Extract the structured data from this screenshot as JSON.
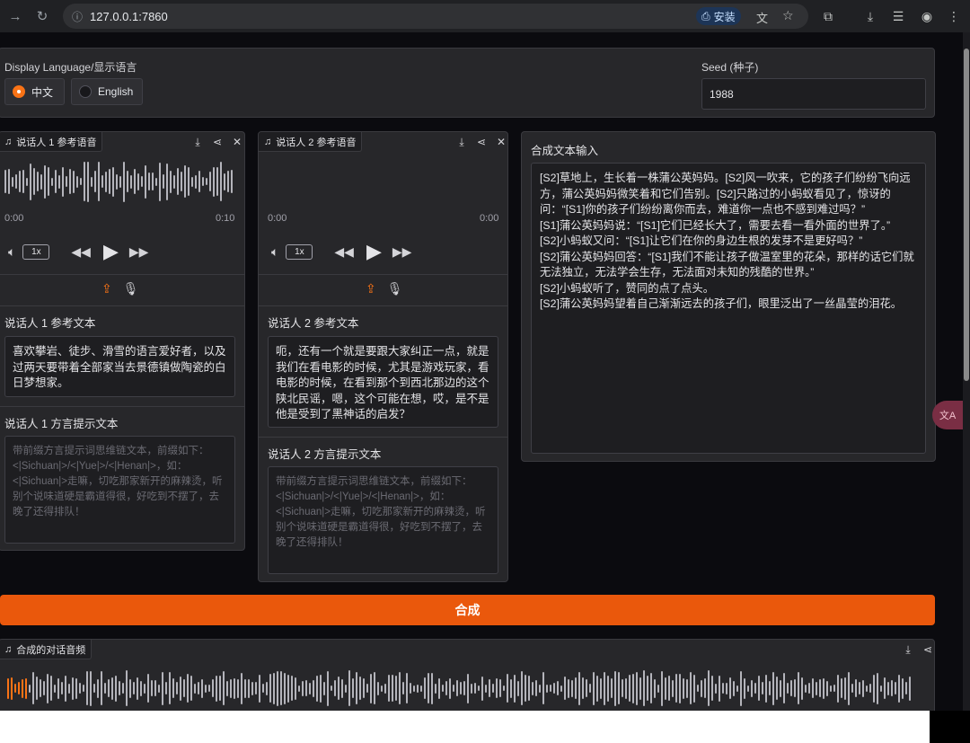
{
  "browser": {
    "url": "127.0.0.1:7860",
    "install_label": "安装"
  },
  "language": {
    "label": "Display Language/显示语言",
    "options": [
      "中文",
      "English"
    ],
    "selected": "中文"
  },
  "seed": {
    "label": "Seed (种子)",
    "value": "1988"
  },
  "speaker1": {
    "audio_label": "说话人 1 参考语音",
    "time_start": "0:00",
    "time_end": "0:10",
    "speed": "1x",
    "text_label": "说话人 1 参考文本",
    "text_value": "喜欢攀岩、徒步、滑雪的语言爱好者，以及过两天要带着全部家当去景德镇做陶瓷的白日梦想家。",
    "dialect_label": "说话人 1 方言提示文本",
    "dialect_placeholder": "带前缀方言提示词思维链文本，前缀如下：<|Sichuan|>/<|Yue|>/<|Henan|>，如：<|Sichuan|>走嘛，切吃那家新开的麻辣烫，听别个说味道硬是霸道得很，好吃到不摆了，去晚了还得排队！"
  },
  "speaker2": {
    "audio_label": "说话人 2 参考语音",
    "time_start": "0:00",
    "time_end": "0:00",
    "speed": "1x",
    "text_label": "说话人 2 参考文本",
    "text_value": "呃，还有一个就是要跟大家纠正一点，就是我们在看电影的时候，尤其是游戏玩家，看电影的时候，在看到那个到西北那边的这个陕北民谣，嗯，这个可能在想，哎，是不是他是受到了黑神话的启发？",
    "dialect_label": "说话人 2 方言提示文本",
    "dialect_placeholder": "带前缀方言提示词思维链文本，前缀如下：<|Sichuan|>/<|Yue|>/<|Henan|>，如：<|Sichuan|>走嘛，切吃那家新开的麻辣烫，听别个说味道硬是霸道得很，好吃到不摆了，去晚了还得排队！"
  },
  "synthesis_input": {
    "label": "合成文本输入",
    "value": "[S2]草地上，生长着一株蒲公英妈妈。[S2]风一吹来，它的孩子们纷纷飞向远方，蒲公英妈妈微笑着和它们告别。[S2]只路过的小蚂蚁看见了，惊讶的问：“[S1]你的孩子们纷纷离你而去，难道你一点也不感到难过吗？”\n[S1]蒲公英妈妈说：“[S1]它们已经长大了，需要去看一看外面的世界了。”\n[S2]小蚂蚁又问：“[S1]让它们在你的身边生根的发芽不是更好吗？”\n[S2]蒲公英妈妈回答：“[S1]我们不能让孩子做温室里的花朵，那样的话它们就无法独立，无法学会生存，无法面对未知的残酷的世界。”\n[S2]小蚂蚁听了，赞同的点了点头。\n[S2]蒲公英妈妈望着自己渐渐远去的孩子们，眼里泛出了一丝晶莹的泪花。"
  },
  "synthesize_button": "合成",
  "output_audio": {
    "label": "合成的对话音频"
  },
  "colors": {
    "accent": "#ea580c",
    "panel": "#27272a",
    "background": "#0b0b0f"
  }
}
